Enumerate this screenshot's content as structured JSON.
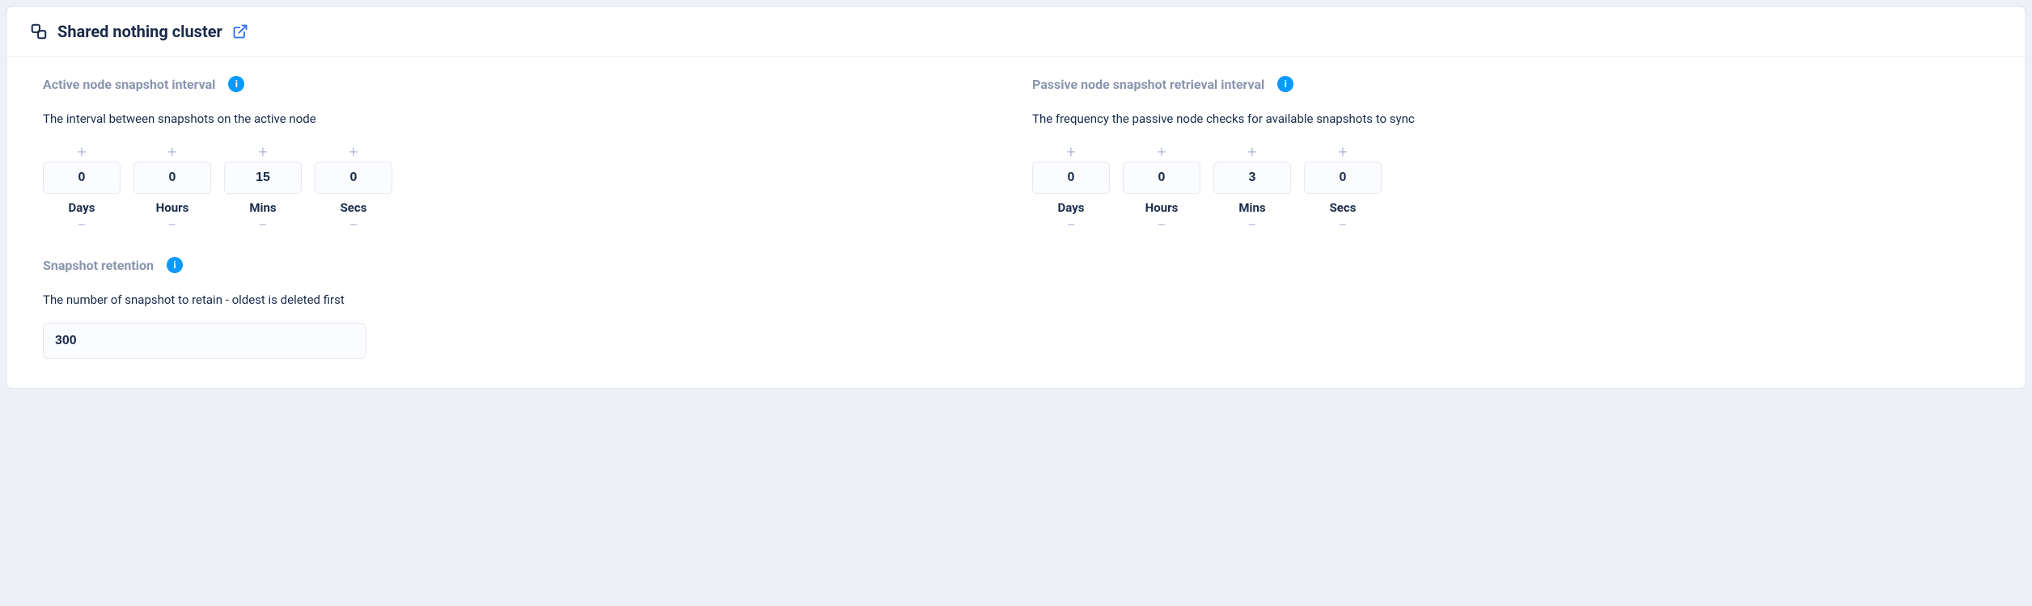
{
  "panel": {
    "title": "Shared nothing cluster"
  },
  "active": {
    "title": "Active node snapshot interval",
    "desc": "The interval between snapshots on the active node",
    "units": [
      {
        "value": "0",
        "label": "Days"
      },
      {
        "value": "0",
        "label": "Hours"
      },
      {
        "value": "15",
        "label": "Mins"
      },
      {
        "value": "0",
        "label": "Secs"
      }
    ]
  },
  "passive": {
    "title": "Passive node snapshot retrieval interval",
    "desc": "The frequency the passive node checks for available snapshots to sync",
    "units": [
      {
        "value": "0",
        "label": "Days"
      },
      {
        "value": "0",
        "label": "Hours"
      },
      {
        "value": "3",
        "label": "Mins"
      },
      {
        "value": "0",
        "label": "Secs"
      }
    ]
  },
  "retention": {
    "title": "Snapshot retention",
    "desc": "The number of snapshot to retain - oldest is deleted first",
    "value": "300"
  }
}
